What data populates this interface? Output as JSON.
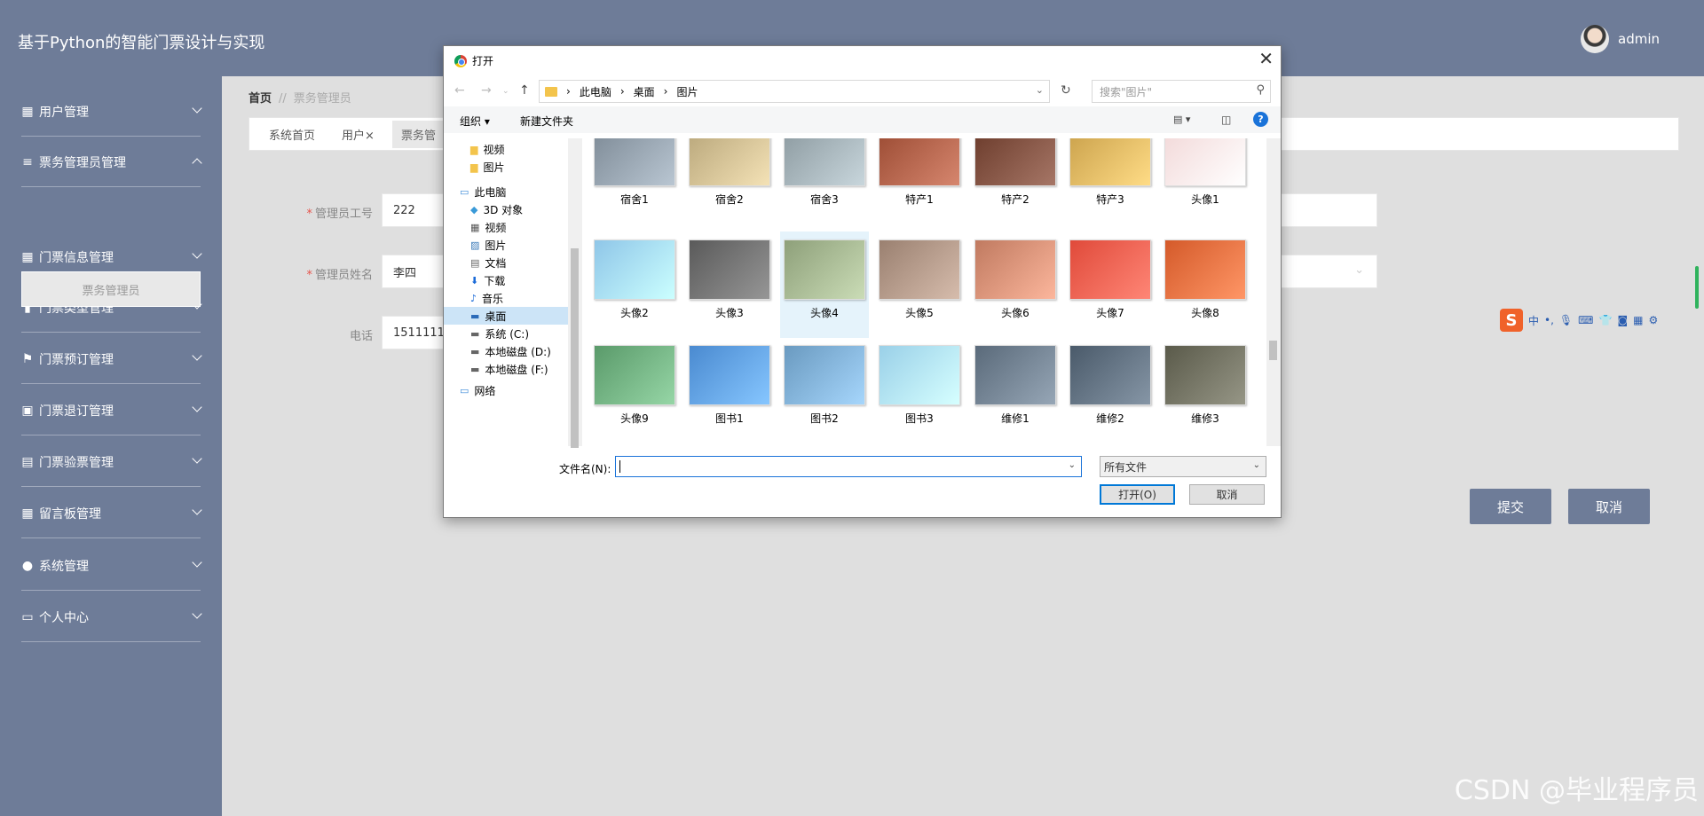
{
  "app": {
    "title": "基于Python的智能门票设计与实现",
    "user": "admin"
  },
  "sidebar": {
    "items": [
      {
        "label": "用户管理",
        "icon": "grid-icon"
      },
      {
        "label": "票务管理员管理",
        "icon": "list-icon",
        "expanded": true
      },
      {
        "label": "门票信息管理",
        "icon": "grid-icon"
      },
      {
        "label": "门票类型管理",
        "icon": "bar-chart-icon"
      },
      {
        "label": "门票预订管理",
        "icon": "flag-icon"
      },
      {
        "label": "门票退订管理",
        "icon": "clipboard-check-icon"
      },
      {
        "label": "门票验票管理",
        "icon": "clipboard-icon"
      },
      {
        "label": "留言板管理",
        "icon": "grid-icon"
      },
      {
        "label": "系统管理",
        "icon": "user-icon"
      },
      {
        "label": "个人中心",
        "icon": "calendar-icon"
      }
    ],
    "subitem": "票务管理员"
  },
  "breadcrumb": {
    "home": "首页",
    "separator": "//",
    "current": "票务管理员"
  },
  "tabs": [
    {
      "label": "系统首页"
    },
    {
      "label": "用户",
      "closable": true
    },
    {
      "label": "票务管"
    }
  ],
  "form": {
    "id_label": "管理员工号",
    "id_value": "222",
    "name_label": "管理员姓名",
    "name_value": "李四",
    "phone_label": "电话",
    "phone_value": "1511111"
  },
  "buttons": {
    "submit": "提交",
    "cancel": "取消"
  },
  "watermark": "CSDN @毕业程序员",
  "ime": {
    "zh": "中"
  },
  "dialog": {
    "title": "打开",
    "path": [
      "此电脑",
      "桌面",
      "图片"
    ],
    "search_placeholder": "搜索\"图片\"",
    "organize": "组织 ▾",
    "new_folder": "新建文件夹",
    "tree": [
      {
        "label": "视频",
        "icon": "folder-icon"
      },
      {
        "label": "图片",
        "icon": "folder-icon"
      },
      {
        "label": "此电脑",
        "icon": "computer-icon"
      },
      {
        "label": "3D 对象",
        "icon": "cube-icon"
      },
      {
        "label": "视频",
        "icon": "film-icon"
      },
      {
        "label": "图片",
        "icon": "picture-icon"
      },
      {
        "label": "文档",
        "icon": "document-icon"
      },
      {
        "label": "下载",
        "icon": "download-icon"
      },
      {
        "label": "音乐",
        "icon": "music-icon"
      },
      {
        "label": "桌面",
        "icon": "desktop-icon",
        "selected": true
      },
      {
        "label": "系统 (C:)",
        "icon": "drive-icon"
      },
      {
        "label": "本地磁盘 (D:)",
        "icon": "drive-icon"
      },
      {
        "label": "本地磁盘 (F:)",
        "icon": "drive-icon"
      },
      {
        "label": "网络",
        "icon": "network-icon"
      }
    ],
    "files": [
      {
        "name": "宿舍1",
        "color": "#7d8a96"
      },
      {
        "name": "宿舍2",
        "color": "#b8a67a"
      },
      {
        "name": "宿舍3",
        "color": "#8c9aa0"
      },
      {
        "name": "特产1",
        "color": "#9a4a32"
      },
      {
        "name": "特产2",
        "color": "#6a3a2a"
      },
      {
        "name": "特产3",
        "color": "#c9a04a"
      },
      {
        "name": "头像1",
        "color": "#f2d8d8"
      },
      {
        "name": "头像2",
        "color": "#8fc6e8"
      },
      {
        "name": "头像3",
        "color": "#5a5a5a"
      },
      {
        "name": "头像4",
        "color": "#8ea07a"
      },
      {
        "name": "头像5",
        "color": "#9a8070"
      },
      {
        "name": "头像6",
        "color": "#c07a60"
      },
      {
        "name": "头像7",
        "color": "#e04a3a"
      },
      {
        "name": "头像8",
        "color": "#d45a2a"
      },
      {
        "name": "头像9",
        "color": "#5a9a6a"
      },
      {
        "name": "图书1",
        "color": "#4a8ad0"
      },
      {
        "name": "图书2",
        "color": "#6a9ac0"
      },
      {
        "name": "图书3",
        "color": "#9ad0e8"
      },
      {
        "name": "维修1",
        "color": "#5a6a7a"
      },
      {
        "name": "维修2",
        "color": "#4a5a6a"
      },
      {
        "name": "维修3",
        "color": "#5a5a4a"
      }
    ],
    "filename_label": "文件名(N):",
    "filename_value": "",
    "filetype": "所有文件",
    "open_button": "打开(O)",
    "cancel_button": "取消"
  }
}
